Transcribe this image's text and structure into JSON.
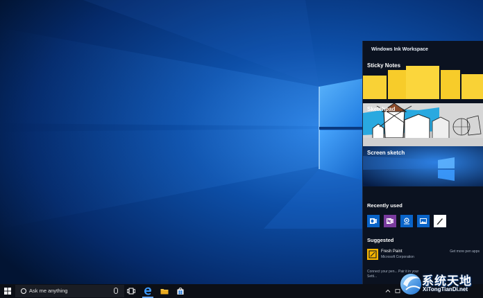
{
  "ink_workspace": {
    "title": "Windows Ink Workspace",
    "sticky_notes_label": "Sticky Notes",
    "sketchpad_label": "Sketchpad",
    "screen_sketch_label": "Screen sketch",
    "recently_used_label": "Recently used",
    "recent_apps": [
      {
        "icon": "outlook-icon",
        "color": "#0a64c8"
      },
      {
        "icon": "onenote-icon",
        "color": "#7a3b9e"
      },
      {
        "icon": "maps-icon",
        "color": "#0a64c8"
      },
      {
        "icon": "photos-icon",
        "color": "#0a64c8"
      },
      {
        "icon": "pen-app-icon",
        "color": "#ffffff"
      }
    ],
    "suggested_label": "Suggested",
    "suggested_app": {
      "name": "Fresh Paint",
      "publisher": "Microsoft Corporation",
      "more_link": "Get more pen apps"
    },
    "connect_text": "Connect your pen... Pair it in your Setti..."
  },
  "taskbar": {
    "search_placeholder": "Ask me anything",
    "icons": [
      "start-icon",
      "cortana-icon",
      "microphone-icon",
      "task-view-icon",
      "edge-icon",
      "file-explorer-icon",
      "store-icon"
    ],
    "tray_icons": [
      "chevron-up-icon",
      "action-center-icon"
    ]
  },
  "watermark": {
    "text_cn": "系统天地",
    "text_en": "XiTongTianDi.net"
  },
  "colors": {
    "accent": "#1a73d9",
    "sticky_yellow": "#f9d236",
    "panel_bg": "#0b1220"
  }
}
